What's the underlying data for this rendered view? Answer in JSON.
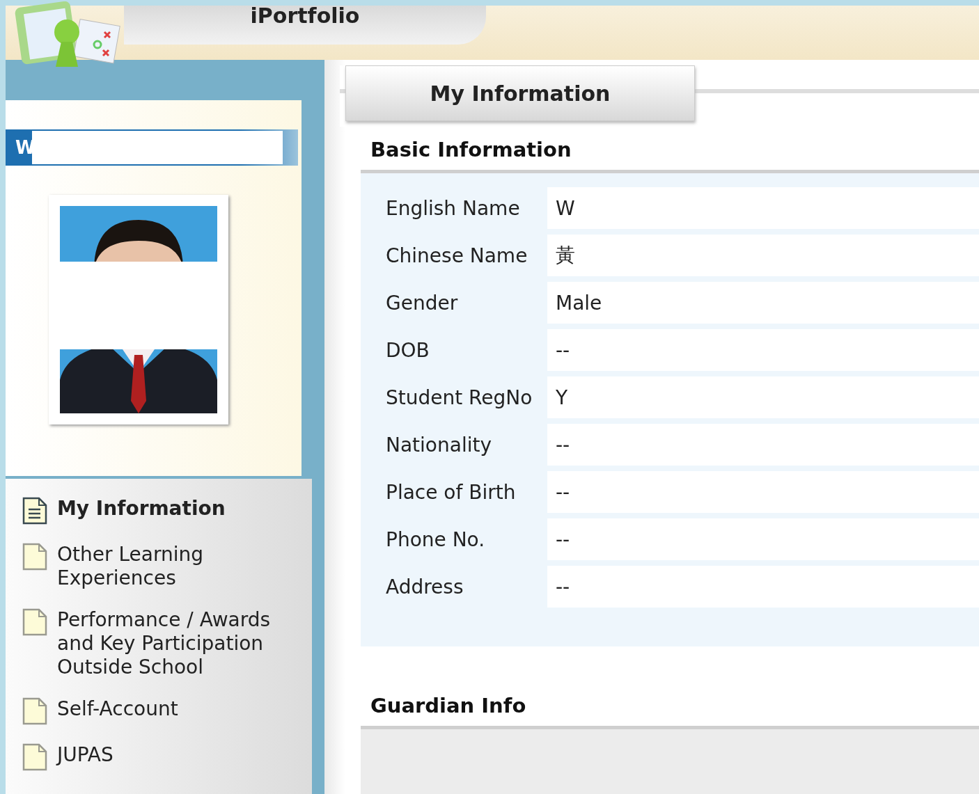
{
  "header": {
    "title": "iPortfolio"
  },
  "profile": {
    "name": "W"
  },
  "sidebar": {
    "items": [
      {
        "label": "My Information",
        "selected": true
      },
      {
        "label": "Other Learning Experiences",
        "selected": false
      },
      {
        "label": "Performance / Awards and Key Participation Outside School",
        "selected": false
      },
      {
        "label": "Self-Account",
        "selected": false
      },
      {
        "label": "JUPAS",
        "selected": false
      }
    ]
  },
  "tabs": [
    {
      "label": "My Information",
      "selected": true
    }
  ],
  "sections": [
    {
      "title": "Basic Information",
      "fields": [
        {
          "label": "English Name",
          "value": "W"
        },
        {
          "label": "Chinese Name",
          "value": "黃"
        },
        {
          "label": "Gender",
          "value": "Male"
        },
        {
          "label": "DOB",
          "value": "--"
        },
        {
          "label": "Student RegNo",
          "value": "Y"
        },
        {
          "label": "Nationality",
          "value": "--"
        },
        {
          "label": "Place of Birth",
          "value": "--"
        },
        {
          "label": "Phone No.",
          "value": "--"
        },
        {
          "label": "Address",
          "value": "--"
        }
      ]
    },
    {
      "title": "Guardian Info"
    }
  ]
}
